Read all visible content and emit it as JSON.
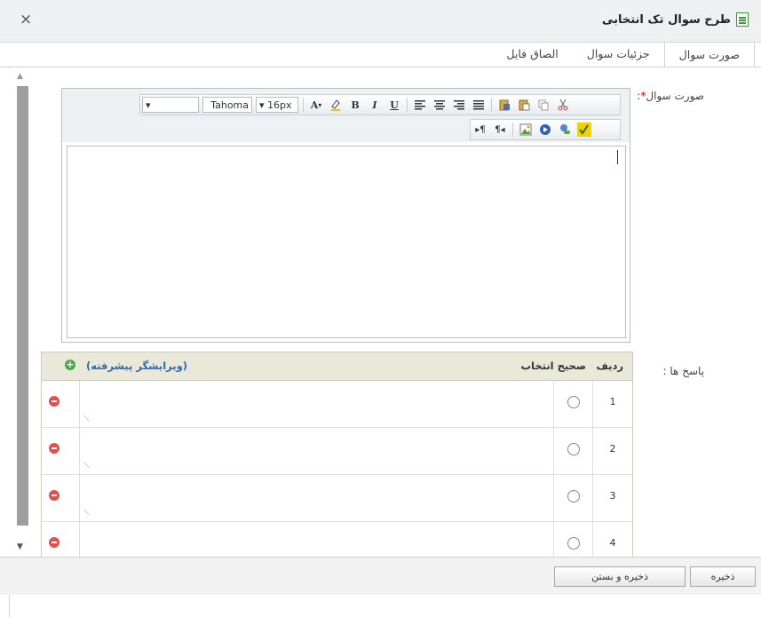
{
  "dialog": {
    "title": "طرح سوال تک انتخابی",
    "close_label": "×"
  },
  "tabs": [
    {
      "label": "صورت سوال",
      "active": true
    },
    {
      "label": "جزئیات سوال",
      "active": false
    },
    {
      "label": "الصاق فایل",
      "active": false
    }
  ],
  "form": {
    "question_label": "صورت سوال",
    "required_mark": "*",
    "question_colon": ":",
    "answers_label": "پاسخ ها :"
  },
  "toolbar": {
    "font_family": "Tahoma",
    "font_size": "16px",
    "format_dropdown": "",
    "dropdown_arrow": "▾",
    "font_color_glyph": "A",
    "bold_glyph": "B",
    "italic_glyph": "I",
    "underline_glyph": "U"
  },
  "answers_table": {
    "col_row": "ردیف",
    "col_correct": "صحیح انتخاب",
    "advanced_editor_link": "(ویرایشگر پیشرفته)",
    "rows": [
      {
        "num": "1"
      },
      {
        "num": "2"
      },
      {
        "num": "3"
      },
      {
        "num": "4"
      }
    ]
  },
  "footer": {
    "save_label": "ذخیره",
    "save_close_label": "ذخیره و بستن"
  },
  "colors": {
    "accent_green": "#3a9a3a",
    "link_blue": "#2a6ab8",
    "delete_red": "#e05050",
    "table_header_bg": "#e9e8d9"
  }
}
